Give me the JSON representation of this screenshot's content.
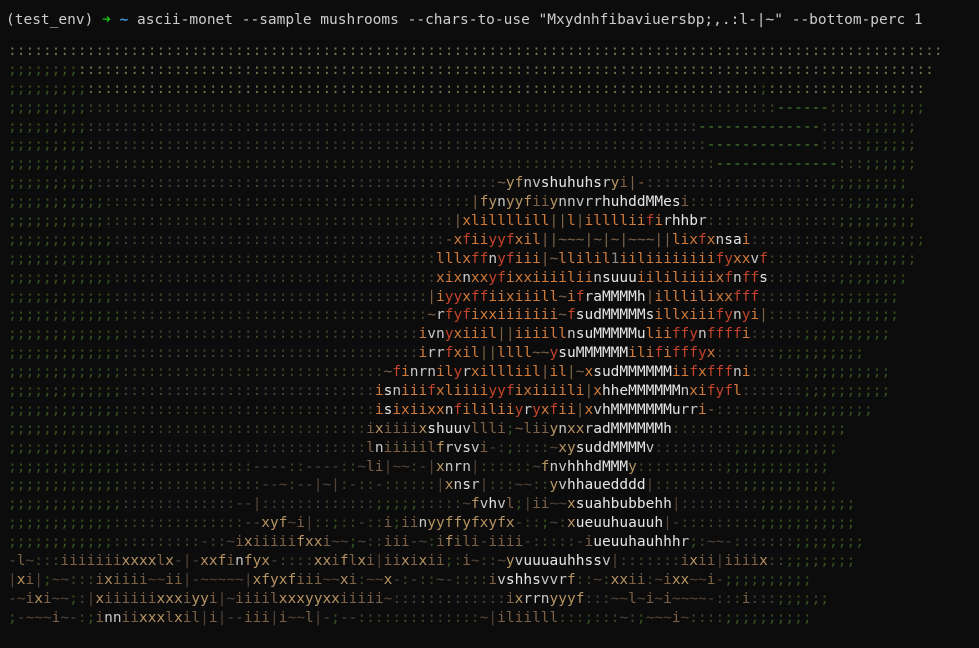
{
  "terminal": {
    "prompt": {
      "env": "(test_env)",
      "arrow": "➜",
      "dir": "~",
      "command": "ascii-monet --sample mushrooms --chars-to-use \"Mxydnhfibaviuersbp;,.:l-|~\" --bottom-perc 1"
    },
    "art_rows": [
      ":::::::::::::::::::::::::::::::::::::::::::::::::::::::::::::::::::::::::::::::::::::::::::::::::::::::::::",
      ";;;;;;;;::::::::::::::::::::::::::::::::::::::::::::::::::::::::::::::::::::::::::::::::::::::::::::::::::",
      ";;;;;;;;;:::::::::::::::::::::::::::::::::::::::::::::::::::::::::::::::::::::::::::::;::::::::::::::::::",
      ";;;;;;;;;:::::::::::::::::::::::::::::::::::::::::::::::::::::::::::::::::::::::::::::::------:::::::;;;;",
      ";;;;;;;;;::::::::::::::::::::::::::::::::::::::::::::::::::::::::::::::::::::::--------------:::::;;;;;;",
      ";;;;;;;;;:::::::::::::::::::::::::::::::::::::::::::::::::::::::::::::::::::::::-------------:::::;;;;;;",
      ";;;;;;;;;::::::::::::::::::::::::::::::::::::::::::::::::::::::::::::::::::::::::--------------:::;;;;;;",
      ";;;;;;;;;;::::::::::::::::::::::::::::::::::::::::::::::~yfnvshuhuhsryi|-:::::::::::::::::::::;;;;;;;;;",
      ";;;;;;;;;;;::::::::::::::::::::::::::::::::::::::::::|fynyyfiiynnvrrhuhddMMesi::::::::::::::::::;;;;;;;;",
      ";;;;;;;;;;;::::::::::::::::::::::::::::::::::::::::|xlillllill||l|illlliifirhhbr:::::::::::::::;;;;;;;;;",
      ";;;;;;;;;;;;::::::::::::::::::::::::::::::::::::::-xfiiyyfxil||~~~|~|~|~~~||lixfxnsai:::::::::::;;;;;;;;;",
      ";;;;;;;;;;;;:::::::::::::::::::::::::::::::::::::lllxffnyfiii|~llilil1iiliiiiiiiifyxxvf:::::::::;;;;;;;;",
      ";;;;;;;;;;;;:::::::::::::::::::::::::::::::::::::xixnxxyfixxiiiiliinsuuuiililiiiixfnffs::::::::;;;;;;;;",
      ";;;;;;;;;;;;::::::::::::::::::::::::::::::::::::|iyyxffiixiiill~ifraMMMMh|illlilixxfff:::::::;;;;;;;;;",
      ";;;;;;;;;;;;;:::::::::::::::::::::::::::::::::::~rfyfixxiiiiiii~fsudMMMMMsillxiiifynyi|::::::;;;;;;;;;",
      ";;;;;;;;;;;;;::::::::::::::::::::::::::::::::::ivnyxiiil||iiiillnsuMMMMMuliiffynffffi::::::;;;;;;;;;;",
      ";;;;;;;;;;;;;::::::::::::::::::::::::::::::::::irrfxil||llll~~ysuMMMMMMilififffyx:::::::;;;;;;;;;;",
      ";;;;;;;;;;;;;::::::::::::::::::::::::::::::~finrnilyrxillliil|il|~xsudMMMMMMiifxfffni::::::;;;;;;;;;;",
      ";;;;;;;;;;;;;:::::::::::::::::::::::::::::isniiifxliiiiyyfixiiiili|xhheMMMMMMnxifyfl:::::::;;;;;;;;;;",
      ";;;;;;;;;;;;;:::::::::::::::::::::::::::::isixiixxnfililiiyryxfii|xvhMMMMMMMurri-:::::::;;;;;;;;;;;",
      ";;;;;;;;;;;;;::::::::::::::::::::::::::::ixiiiixshuuvllli;~liiynxxradMMMMMMh::::::::;;;;;;;;;;;;",
      ";;;;;;;;;;;;;::::::::::::::::::::::::::::lniiiiilfrvsvi-:;::::~xysuddMMMMv:::::::::;;;;;;;;;;;;",
      ";;;;;;;;;;;;;:::::::::::::::----::----::~li|~~:-|xnrn|::::::~fnvhhhdMMMy::::::::::;;;;;;;;;;;;",
      ";;;;;;;;;;;;;::::::::::::::::--~:--|~|:-::-::::::|xnsr|:::~~::yvhhauedddd|::::::::::;;;;;;;;;;;",
      ";;;;;;;;;;;;;:::::::::::::--|:::::::::::::;;;;;:::::~fvhvl;|ii~~xsuahbubbehh|:::::::::;;;;;;;;;;;",
      ";;;;;;;;;;;;:::::::::::::::--xyf~i|::;::-::i;iinyyffyfxyfx-::;~:xueuuhuauuh|-:::::::::;;;;;;;;;;;",
      ";;;;;;;;;;;;::::::::::-::~ixiiiiifxxi~~;~::iii-~:ifili-iiii-:::::-iueuuhauhhhr;:~~-:::::::;;;;;;;;",
      "-l~:::iiiiiiixxxxlx-|-xxfinfyx-::::xxiflxi|iixixii;:i~::~yvuuuauhhssv|:::::::ixii|iiiix::;;;;;;;;",
      "|xi|;~~:::ixiiii~~ii|-~~~~~|xfyxfiii~~xi:~~x-:-::~-::::ivshhsvvrf::~:xxii:~ixx~~i-;;;;;;;;;;",
      "-~ixi~~;:|xiiiiiixxxiyyi|~iiiilxxxyyxxiiiii~:::::::::::::ixrrnyyyf:::~~l~i~i~~~~-:::i:::;;;;;;",
      ";-~~~i~-:;inniixxxlxil|i|--iii|i~~l|-;--::::::::::::::~|iliilll:::;:::~:;~~~i~::::;;;;;;;;;;"
    ]
  }
}
